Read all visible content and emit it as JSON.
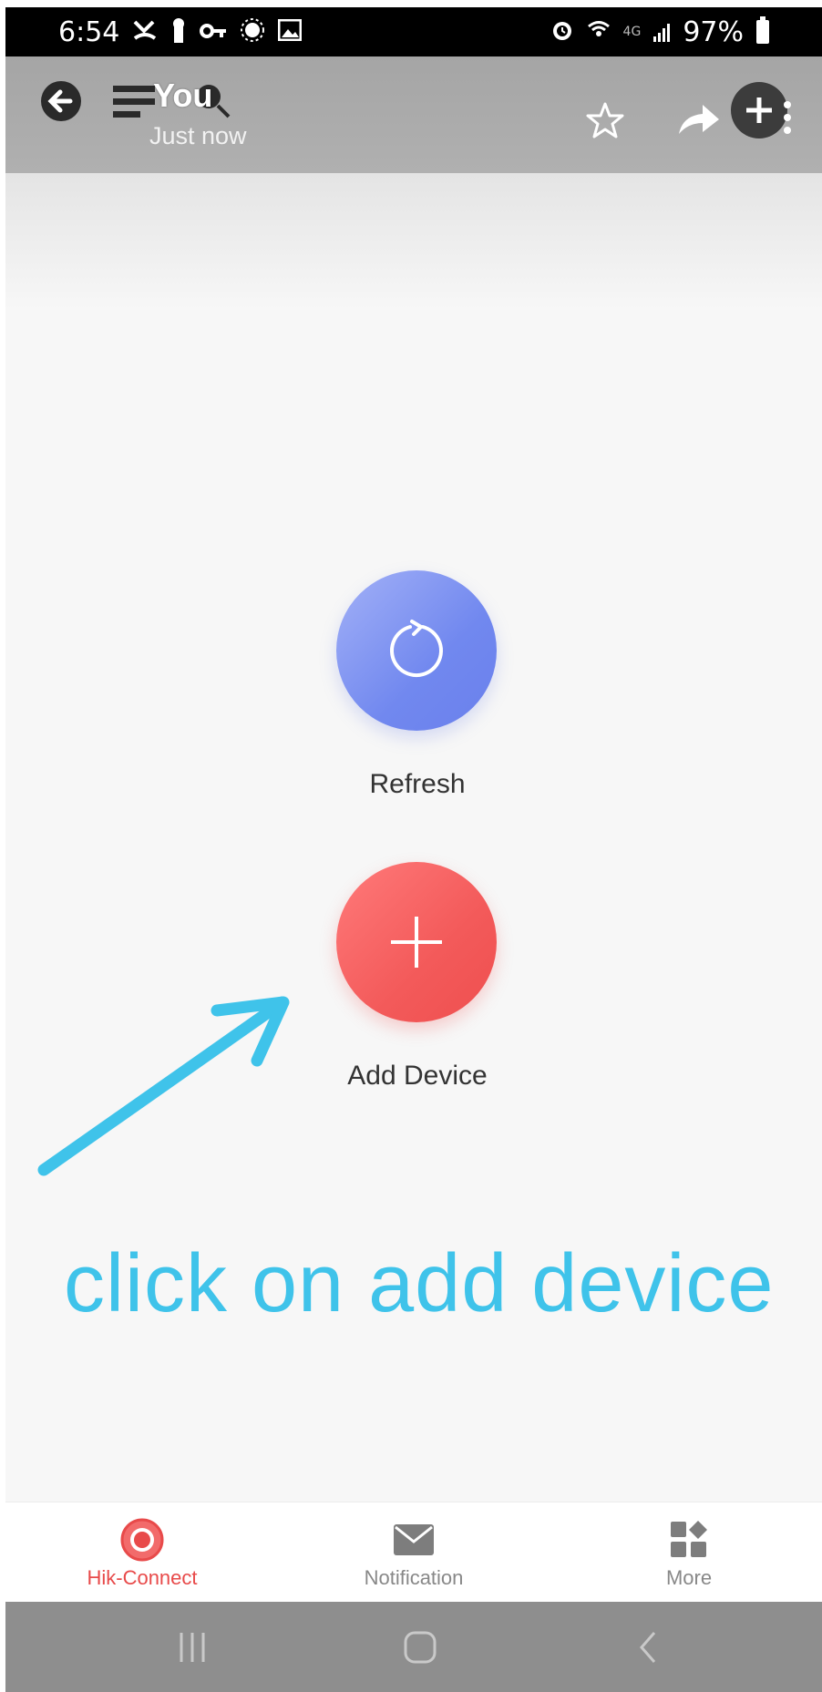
{
  "status_bar": {
    "time": "6:54",
    "network": "4G",
    "battery": "97%"
  },
  "header": {
    "title": "You",
    "subtitle": "Just now"
  },
  "main": {
    "refresh_label": "Refresh",
    "add_device_label": "Add Device"
  },
  "annotation": {
    "text": "click on add device",
    "color": "#3fc3ea"
  },
  "bottom_nav": {
    "items": [
      {
        "label": "Hik-Connect",
        "icon": "hik-connect-icon",
        "active": true
      },
      {
        "label": "Notification",
        "icon": "mail-icon",
        "active": false
      },
      {
        "label": "More",
        "icon": "apps-grid-icon",
        "active": false
      }
    ]
  },
  "colors": {
    "refresh": "#7188ef",
    "add_device": "#f35a5a",
    "active_nav": "#e84a4a"
  }
}
